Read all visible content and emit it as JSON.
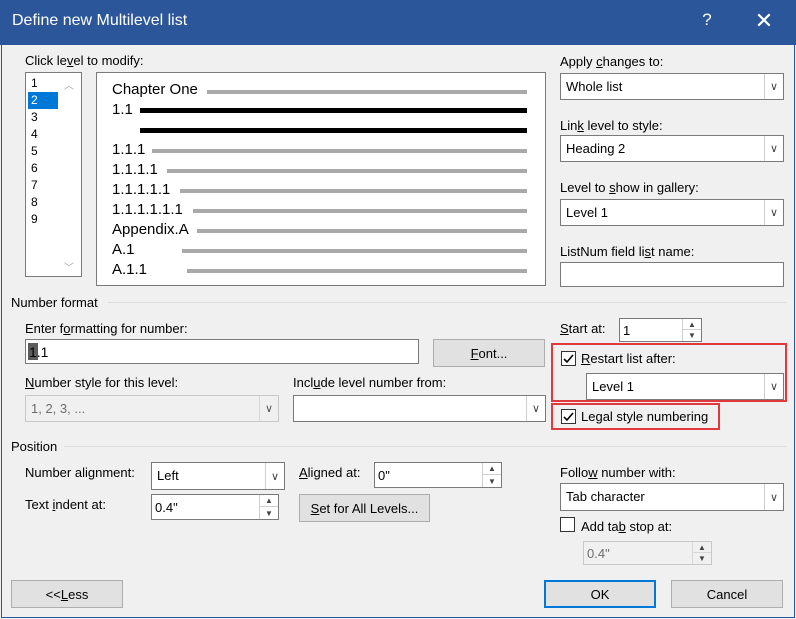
{
  "title": "Define new Multilevel list",
  "title_help": "?",
  "title_close": "✕",
  "levels": {
    "label_pre": "Click le",
    "label_ul": "v",
    "label_post": "el to modify:",
    "items": [
      "1",
      "2",
      "3",
      "4",
      "5",
      "6",
      "7",
      "8",
      "9"
    ],
    "selected": "2"
  },
  "preview": {
    "lines": [
      "Chapter One",
      "1.1",
      "1.1.1",
      "1.1.1.1",
      "1.1.1.1.1",
      "1.1.1.1.1.1",
      "Appendix.A",
      "A.1",
      "A.1.1"
    ]
  },
  "apply_changes": {
    "label_pre": "Apply ",
    "label_ul": "c",
    "label_post": "hanges to:",
    "value": "Whole list"
  },
  "link_level": {
    "label_pre": "Lin",
    "label_ul": "k",
    "label_post": " level to style:",
    "value": "Heading 2"
  },
  "gallery_level": {
    "label_pre": "Level to ",
    "label_ul": "s",
    "label_post": "how in gallery:",
    "value": "Level 1"
  },
  "listnum": {
    "label_pre": "ListNum field li",
    "label_ul": "s",
    "label_post": "t name:",
    "value": ""
  },
  "number_format": {
    "section_label": "Number format",
    "enter_label_pre": "Enter f",
    "enter_label_ul": "o",
    "enter_label_post": "rmatting for number:",
    "value": "1.1",
    "font_button_ul": "F",
    "font_button_post": "ont...",
    "style_label_ul": "N",
    "style_label_post": "umber style for this level:",
    "style_value": "1, 2, 3, ...",
    "include_label_pre": "Incl",
    "include_label_ul": "u",
    "include_label_post": "de level number from:",
    "include_value": "",
    "start_at_ul": "S",
    "start_at_post": "tart at:",
    "start_at_value": "1",
    "restart_ul": "R",
    "restart_post": "estart list after:",
    "restart_checked": true,
    "restart_value": "Level 1",
    "legal_pre": "Le",
    "legal_ul": "g",
    "legal_post": "al style numbering",
    "legal_checked": true
  },
  "position": {
    "section_label": "Position",
    "alignment_label_pre": "Number ali",
    "alignment_label_ul": "g",
    "alignment_label_post": "nment:",
    "alignment_value": "Left",
    "aligned_at_ul": "A",
    "aligned_at_post": "ligned at:",
    "aligned_at_value": "0\"",
    "indent_label_pre": "Text ",
    "indent_label_ul": "i",
    "indent_label_post": "ndent at:",
    "indent_value": "0.4\"",
    "set_all_ul": "S",
    "set_all_post": "et for All Levels...",
    "follow_label_pre": "Follo",
    "follow_label_ul": "w",
    "follow_label_post": " number with:",
    "follow_value": "Tab character",
    "add_tab_pre": "Add ta",
    "add_tab_ul": "b",
    "add_tab_post": " stop at:",
    "add_tab_checked": false,
    "add_tab_value": "0.4\""
  },
  "buttons": {
    "less_pre": "<< ",
    "less_ul": "L",
    "less_post": "ess",
    "ok": "OK",
    "cancel": "Cancel"
  },
  "colors": {
    "title_bar": "#2b579a",
    "selection": "#0078d7",
    "highlight": "#e0393e"
  }
}
